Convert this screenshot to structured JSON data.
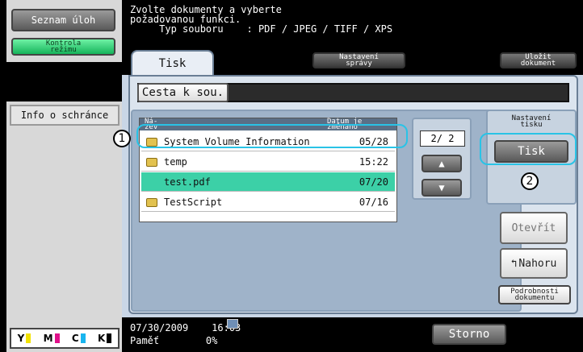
{
  "left": {
    "task_list_label": "Seznam úloh",
    "check_mode_label": "Kontrola\nrežimu",
    "box_info_label": "Info o schránce",
    "toner": [
      "Y",
      "M",
      "C",
      "K"
    ]
  },
  "header": {
    "instruction": "Zvolte dokumenty a vyberte\npožadovanou funkci.\n     Typ souboru    : PDF / JPEG / TIFF / XPS"
  },
  "tabs": {
    "print_label": "Tisk",
    "manage_label": "Nastavení\nsprávy",
    "save_label": "Uložit\ndokument"
  },
  "path_label": "Cesta k sou.",
  "file_list": {
    "col_name": "Ná-\nzev",
    "col_date": "Datum je\nzměnano",
    "page": "2/ 2",
    "rows": [
      {
        "name": "System Volume Information",
        "date": "05/28",
        "folder": true
      },
      {
        "name": "temp",
        "date": "15:22",
        "folder": true
      },
      {
        "name": "test.pdf",
        "date": "07/20",
        "folder": false
      },
      {
        "name": "TestScript",
        "date": "07/16",
        "folder": true
      }
    ]
  },
  "right": {
    "print_settings_title": "Nastavení\ntisku",
    "print_button": "Tisk",
    "open_button": "Otevřít",
    "up_button": "Nahoru",
    "details_button": "Podrobnosti\ndokumentu"
  },
  "footer": {
    "datetime": "07/30/2009    16:03",
    "memory": "Paměť        0%",
    "stop_label": "Storno"
  },
  "callouts": {
    "one": "1",
    "two": "2"
  },
  "colors": {
    "selected_row": "#3cd0a7",
    "callout": "#29c3e6",
    "panel": "#9fb3c9"
  }
}
